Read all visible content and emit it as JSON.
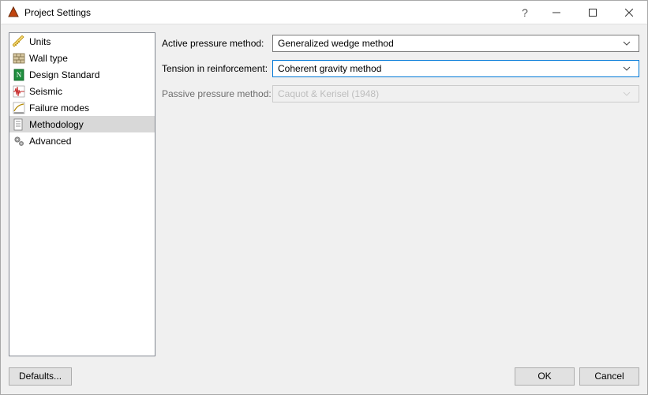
{
  "window": {
    "title": "Project Settings",
    "help_symbol": "?",
    "minimize_tooltip": "Minimize",
    "maximize_tooltip": "Maximize",
    "close_tooltip": "Close"
  },
  "sidebar": {
    "items": [
      {
        "label": "Units",
        "icon": "ruler-icon",
        "selected": false
      },
      {
        "label": "Wall type",
        "icon": "wall-icon",
        "selected": false
      },
      {
        "label": "Design Standard",
        "icon": "standard-icon",
        "selected": false
      },
      {
        "label": "Seismic",
        "icon": "seismic-icon",
        "selected": false
      },
      {
        "label": "Failure modes",
        "icon": "failure-icon",
        "selected": false
      },
      {
        "label": "Methodology",
        "icon": "method-icon",
        "selected": true
      },
      {
        "label": "Advanced",
        "icon": "gears-icon",
        "selected": false
      }
    ]
  },
  "form": {
    "active_pressure": {
      "label": "Active pressure method:",
      "value": "Generalized wedge method",
      "enabled": true,
      "focused": false
    },
    "tension": {
      "label": "Tension in reinforcement:",
      "value": "Coherent gravity method",
      "enabled": true,
      "focused": true
    },
    "passive_pressure": {
      "label": "Passive pressure method:",
      "value": "Caquot & Kerisel (1948)",
      "enabled": false,
      "focused": false
    }
  },
  "footer": {
    "defaults": "Defaults...",
    "ok": "OK",
    "cancel": "Cancel"
  }
}
